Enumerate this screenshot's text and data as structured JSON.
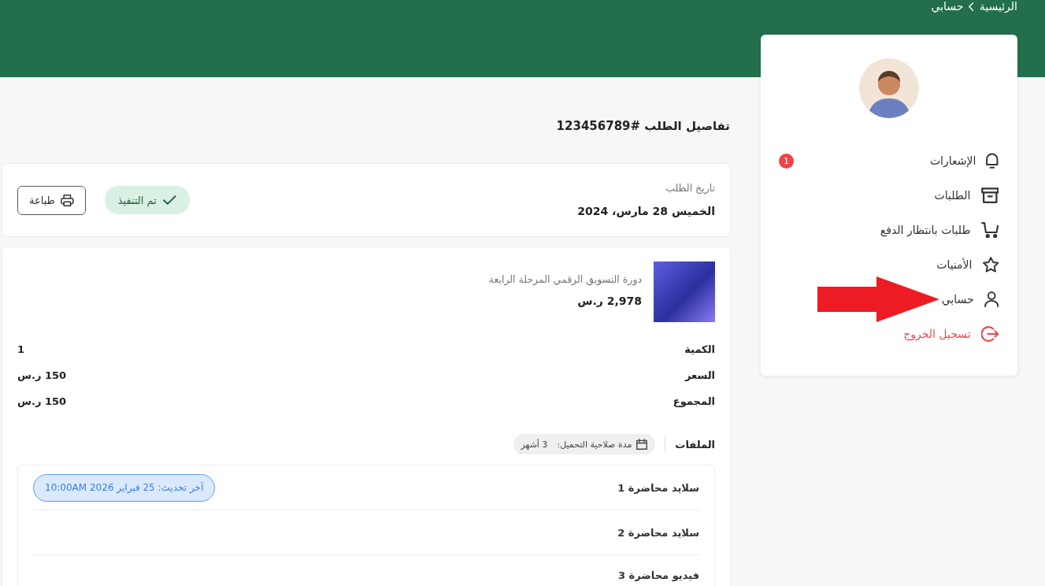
{
  "breadcrumb": [
    {
      "label": "الرئيسية"
    },
    {
      "label": "حسابي"
    }
  ],
  "sidebar": {
    "items": [
      {
        "kind": "notifications",
        "label": "الإشعارات",
        "badge": "1",
        "pointed": false
      },
      {
        "kind": "orders",
        "label": "الطلبات",
        "pointed": false
      },
      {
        "kind": "cart",
        "label": "طلبات بانتظار الدفع",
        "pointed": false
      },
      {
        "kind": "wishlist",
        "label": "الأمنيات",
        "pointed": false
      },
      {
        "kind": "account",
        "label": "حسابي",
        "pointed": true
      },
      {
        "kind": "logout",
        "label": "تسجيل الخروج",
        "pointed": false
      }
    ]
  },
  "page_title": "تفاصيل الطلب #123456789",
  "order": {
    "date_label": "تاريخ الطلب",
    "date": "الخميس 28 مارس، 2024",
    "status": {
      "kind": "completed",
      "label": "تم التنفيذ"
    },
    "print_button": "طباعة"
  },
  "product": {
    "title": "دورة التسويق الرقمي المرحلة الرابعة",
    "price": "2,978 ر.س"
  },
  "details": [
    {
      "label": "الكمية",
      "value": "1"
    },
    {
      "label": "السعر",
      "value": "150 ر.س"
    },
    {
      "label": "المجموع",
      "value": "150 ر.س"
    }
  ],
  "files": {
    "heading": "الملفات",
    "validity_label": "مدة صلاحية التحميل:",
    "validity_value": "3 أشهر",
    "items": [
      {
        "name": "سلايد محاضرة 1",
        "updated": "آخر تحديث: 25 فبراير 2026 10:00AM"
      },
      {
        "name": "سلايد محاضرة 2"
      },
      {
        "name": "فيديو محاضرة 3"
      }
    ]
  }
}
